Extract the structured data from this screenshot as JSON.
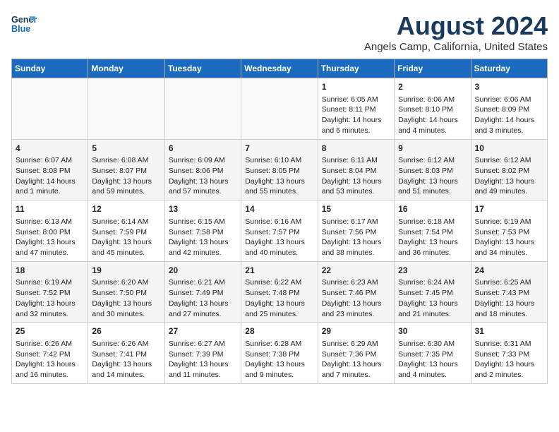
{
  "header": {
    "logo_line1": "General",
    "logo_line2": "Blue",
    "title": "August 2024",
    "subtitle": "Angels Camp, California, United States"
  },
  "days_of_week": [
    "Sunday",
    "Monday",
    "Tuesday",
    "Wednesday",
    "Thursday",
    "Friday",
    "Saturday"
  ],
  "weeks": [
    [
      {
        "day": "",
        "info": ""
      },
      {
        "day": "",
        "info": ""
      },
      {
        "day": "",
        "info": ""
      },
      {
        "day": "",
        "info": ""
      },
      {
        "day": "1",
        "info": "Sunrise: 6:05 AM\nSunset: 8:11 PM\nDaylight: 14 hours\nand 6 minutes."
      },
      {
        "day": "2",
        "info": "Sunrise: 6:06 AM\nSunset: 8:10 PM\nDaylight: 14 hours\nand 4 minutes."
      },
      {
        "day": "3",
        "info": "Sunrise: 6:06 AM\nSunset: 8:09 PM\nDaylight: 14 hours\nand 3 minutes."
      }
    ],
    [
      {
        "day": "4",
        "info": "Sunrise: 6:07 AM\nSunset: 8:08 PM\nDaylight: 14 hours\nand 1 minute."
      },
      {
        "day": "5",
        "info": "Sunrise: 6:08 AM\nSunset: 8:07 PM\nDaylight: 13 hours\nand 59 minutes."
      },
      {
        "day": "6",
        "info": "Sunrise: 6:09 AM\nSunset: 8:06 PM\nDaylight: 13 hours\nand 57 minutes."
      },
      {
        "day": "7",
        "info": "Sunrise: 6:10 AM\nSunset: 8:05 PM\nDaylight: 13 hours\nand 55 minutes."
      },
      {
        "day": "8",
        "info": "Sunrise: 6:11 AM\nSunset: 8:04 PM\nDaylight: 13 hours\nand 53 minutes."
      },
      {
        "day": "9",
        "info": "Sunrise: 6:12 AM\nSunset: 8:03 PM\nDaylight: 13 hours\nand 51 minutes."
      },
      {
        "day": "10",
        "info": "Sunrise: 6:12 AM\nSunset: 8:02 PM\nDaylight: 13 hours\nand 49 minutes."
      }
    ],
    [
      {
        "day": "11",
        "info": "Sunrise: 6:13 AM\nSunset: 8:00 PM\nDaylight: 13 hours\nand 47 minutes."
      },
      {
        "day": "12",
        "info": "Sunrise: 6:14 AM\nSunset: 7:59 PM\nDaylight: 13 hours\nand 45 minutes."
      },
      {
        "day": "13",
        "info": "Sunrise: 6:15 AM\nSunset: 7:58 PM\nDaylight: 13 hours\nand 42 minutes."
      },
      {
        "day": "14",
        "info": "Sunrise: 6:16 AM\nSunset: 7:57 PM\nDaylight: 13 hours\nand 40 minutes."
      },
      {
        "day": "15",
        "info": "Sunrise: 6:17 AM\nSunset: 7:56 PM\nDaylight: 13 hours\nand 38 minutes."
      },
      {
        "day": "16",
        "info": "Sunrise: 6:18 AM\nSunset: 7:54 PM\nDaylight: 13 hours\nand 36 minutes."
      },
      {
        "day": "17",
        "info": "Sunrise: 6:19 AM\nSunset: 7:53 PM\nDaylight: 13 hours\nand 34 minutes."
      }
    ],
    [
      {
        "day": "18",
        "info": "Sunrise: 6:19 AM\nSunset: 7:52 PM\nDaylight: 13 hours\nand 32 minutes."
      },
      {
        "day": "19",
        "info": "Sunrise: 6:20 AM\nSunset: 7:50 PM\nDaylight: 13 hours\nand 30 minutes."
      },
      {
        "day": "20",
        "info": "Sunrise: 6:21 AM\nSunset: 7:49 PM\nDaylight: 13 hours\nand 27 minutes."
      },
      {
        "day": "21",
        "info": "Sunrise: 6:22 AM\nSunset: 7:48 PM\nDaylight: 13 hours\nand 25 minutes."
      },
      {
        "day": "22",
        "info": "Sunrise: 6:23 AM\nSunset: 7:46 PM\nDaylight: 13 hours\nand 23 minutes."
      },
      {
        "day": "23",
        "info": "Sunrise: 6:24 AM\nSunset: 7:45 PM\nDaylight: 13 hours\nand 21 minutes."
      },
      {
        "day": "24",
        "info": "Sunrise: 6:25 AM\nSunset: 7:43 PM\nDaylight: 13 hours\nand 18 minutes."
      }
    ],
    [
      {
        "day": "25",
        "info": "Sunrise: 6:26 AM\nSunset: 7:42 PM\nDaylight: 13 hours\nand 16 minutes."
      },
      {
        "day": "26",
        "info": "Sunrise: 6:26 AM\nSunset: 7:41 PM\nDaylight: 13 hours\nand 14 minutes."
      },
      {
        "day": "27",
        "info": "Sunrise: 6:27 AM\nSunset: 7:39 PM\nDaylight: 13 hours\nand 11 minutes."
      },
      {
        "day": "28",
        "info": "Sunrise: 6:28 AM\nSunset: 7:38 PM\nDaylight: 13 hours\nand 9 minutes."
      },
      {
        "day": "29",
        "info": "Sunrise: 6:29 AM\nSunset: 7:36 PM\nDaylight: 13 hours\nand 7 minutes."
      },
      {
        "day": "30",
        "info": "Sunrise: 6:30 AM\nSunset: 7:35 PM\nDaylight: 13 hours\nand 4 minutes."
      },
      {
        "day": "31",
        "info": "Sunrise: 6:31 AM\nSunset: 7:33 PM\nDaylight: 13 hours\nand 2 minutes."
      }
    ]
  ]
}
